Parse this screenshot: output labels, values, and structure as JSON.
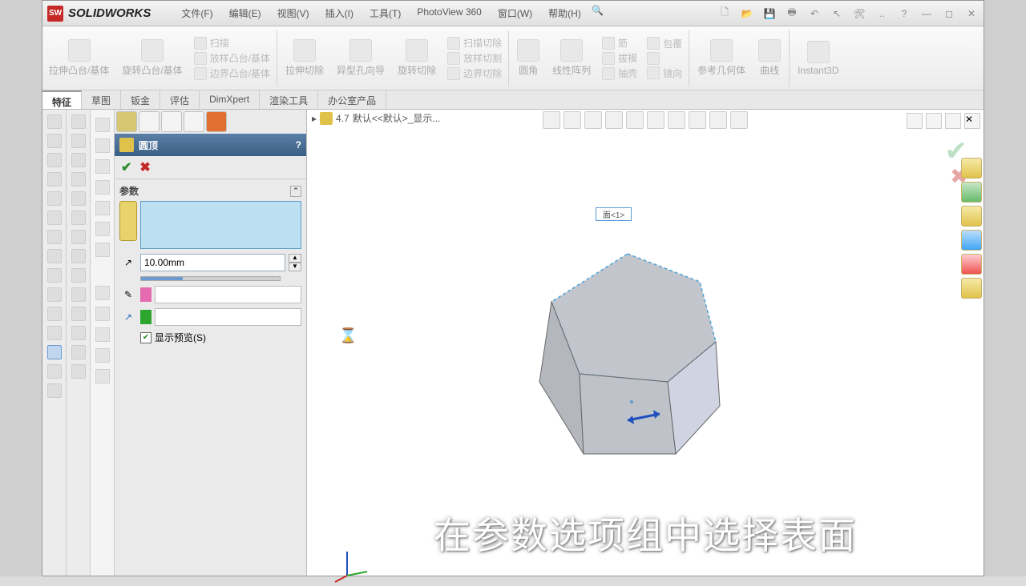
{
  "app": {
    "title": "SOLIDWORKS"
  },
  "menu": {
    "file": "文件(F)",
    "edit": "编辑(E)",
    "view": "视图(V)",
    "insert": "插入(I)",
    "tools": "工具(T)",
    "photoview": "PhotoView 360",
    "window": "窗口(W)",
    "help": "帮助(H)"
  },
  "ribbon": {
    "extrude_boss": "拉伸凸台/基体",
    "revolve_boss": "旋转凸台/基体",
    "swept_boss": "扫描",
    "loft_boss": "放样凸台/基体",
    "boundary_boss": "边界凸台/基体",
    "extrude_cut": "拉伸切除",
    "hole_wizard": "异型孔向导",
    "revolve_cut": "旋转切除",
    "swept_cut": "扫描切除",
    "loft_cut": "放样切割",
    "boundary_cut": "边界切除",
    "fillet": "圆角",
    "linear_pattern": "线性阵列",
    "rib": "筋",
    "shell": "抽壳",
    "draft": "拔模",
    "wrap": "包覆",
    "mirror": "镜向",
    "ref_geom": "参考几何体",
    "curves": "曲线",
    "instant3d": "Instant3D"
  },
  "tabs": {
    "features": "特征",
    "sketch": "草图",
    "sheetmetal": "钣金",
    "evaluate": "评估",
    "dimxpert": "DimXpert",
    "render": "渲染工具",
    "office": "办公室产品"
  },
  "prop": {
    "title": "圆顶",
    "section": "参数",
    "distance": "10.00mm",
    "preview_label": "显示预览(S)"
  },
  "breadcrumb": {
    "part": "4.7",
    "config": "默认<<默认>_显示..."
  },
  "face_label": "面<1>",
  "caption": "在参数选项组中选择表面"
}
